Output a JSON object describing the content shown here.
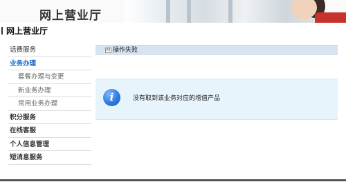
{
  "header": {
    "title": "网上营业厅"
  },
  "subheader": {
    "title": "网上营业厅"
  },
  "sidebar": {
    "items": [
      {
        "label": "话费服务"
      },
      {
        "label": "业务办理"
      },
      {
        "label": "套餐办理与变更"
      },
      {
        "label": "新业务办理"
      },
      {
        "label": "常用业务办理"
      },
      {
        "label": "积分服务"
      },
      {
        "label": "在线客服"
      },
      {
        "label": "个人信息管理"
      },
      {
        "label": "短消息服务"
      }
    ]
  },
  "main": {
    "status_icon_glyph": "M",
    "status_text": "操作失败",
    "message_icon_glyph": "i",
    "message_text": "没有取到该业务对应的增值产品"
  },
  "colors": {
    "active_nav": "#1468c8",
    "status_bar": "#d7e3f1",
    "message_box": "#e8f4fb"
  }
}
